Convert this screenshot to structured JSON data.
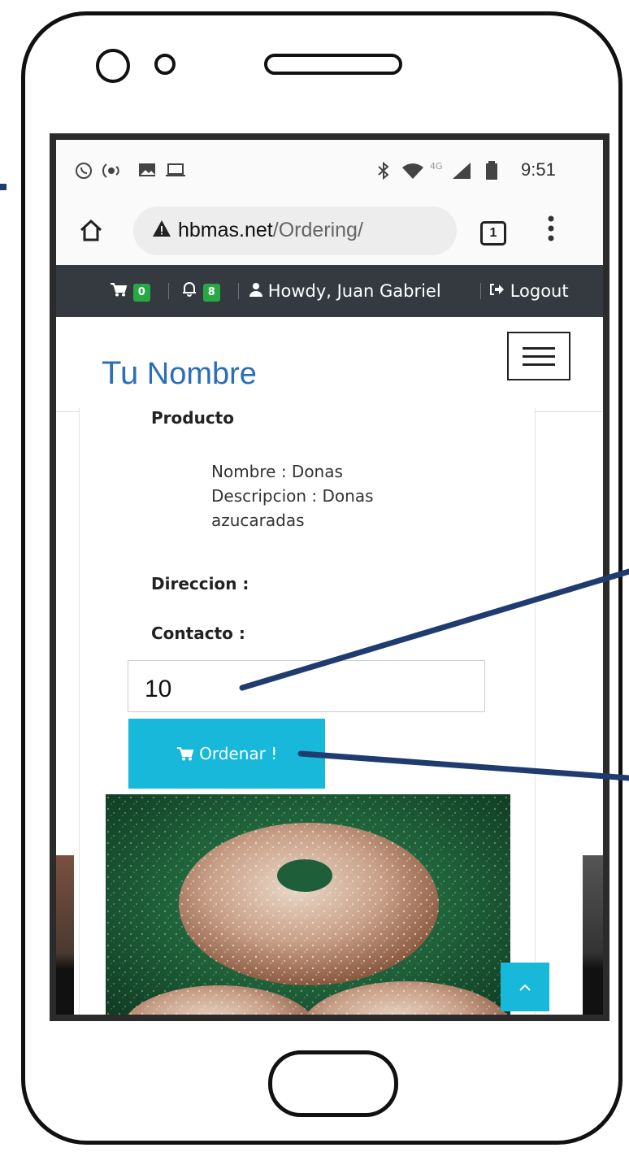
{
  "statusbar": {
    "icons": [
      "whatsapp-icon",
      "hotspot-icon",
      "gallery-icon",
      "laptop-icon",
      "bluetooth-icon",
      "wifi-icon",
      "network-4g-icon",
      "signal-icon",
      "battery-icon"
    ],
    "network_label": "4G",
    "time": "9:51"
  },
  "browser": {
    "url_domain": "hbmas.net",
    "url_path": "/Ordering/",
    "tab_count": "1"
  },
  "nav": {
    "cart_count": "0",
    "notification_count": "8",
    "greeting": "Howdy, Juan Gabriel",
    "logout_label": "Logout"
  },
  "brand": {
    "part1": "Tu",
    "part2": "Nombre"
  },
  "order": {
    "producto_label": "Producto",
    "nombre": "Nombre : Donas",
    "descripcion_line1": "Descripcion : Donas",
    "descripcion_line2": "azucaradas",
    "direccion_label": "Direccion :",
    "contacto_label": "Contacto :",
    "quantity_value": "10",
    "order_button_label": "Ordenar !"
  },
  "colors": {
    "nav_bg": "#343a40",
    "badge": "#28a745",
    "brand": "#2a6ebb",
    "accent_button": "#17b8d9",
    "annotation_arrow": "#1f3b70"
  }
}
